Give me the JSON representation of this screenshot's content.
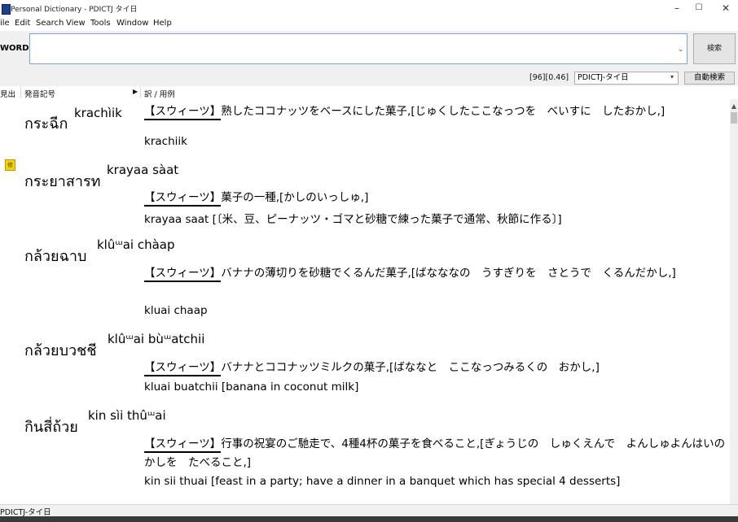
{
  "window": {
    "title": "Personal Dictionary - PDICTJ タイ日",
    "minimize": "–",
    "maximize": "☐"
  },
  "menu": [
    "ile",
    "Edit",
    "Search",
    "View",
    "Tools",
    "Window",
    "Help"
  ],
  "toolbar": {
    "word_label": "WORD",
    "search_value": "",
    "search_button": "検索"
  },
  "status": {
    "counter": "[96][0.46]",
    "dictionary": "PDICTJ-タイ日",
    "auto_search": "自動検索"
  },
  "columns": {
    "word": "見出",
    "pronunciation": "発音記号",
    "translation": "訳 / 用例"
  },
  "entries": [
    {
      "thai": "กระฉีก",
      "pron": "krachìik",
      "gloss": "【スウィーツ】熟したココナッツをベースにした菓子,[じゅくしたここなっつを　べいすに　したおかし,]",
      "extra": "krachiik"
    },
    {
      "thai": "กระยาสารท",
      "pron": "krayaa sàat",
      "gloss": "【スウィーツ】菓子の一種,[かしのいっしゅ,]",
      "extra": "krayaa saat [〔米、豆、ピーナッツ・ゴマと砂糖で練った菓子で通常、秋節に作る〕]"
    },
    {
      "thai": "กล้วยฉาบ",
      "pron": "klûᵚai chàap",
      "gloss": "【スウィーツ】バナナの薄切りを砂糖でくるんだ菓子,[ばなななの　うすぎりを　さとうで　くるんだかし,]",
      "extra": "kluai chaap"
    },
    {
      "thai": "กล้วยบวชชี",
      "pron": "klûᵚai bùᵚatchii",
      "gloss": "【スウィーツ】バナナとココナッツミルクの菓子,[ばななと　ここなっつみるくの　おかし,]",
      "extra": "kluai buatchii [banana in coconut milk]"
    },
    {
      "thai": "กินสี่ถ้วย",
      "pron": "kin sìi thûᵚai",
      "gloss": "【スウィーツ】行事の祝宴のご馳走で、4種4杯の菓子を食べること,[ぎょうじの　しゅくえんで　よんしゅよんはいの　かしを　たべること,]",
      "extra": "kin sii thuai [feast in a party; have a dinner in a banquet which has special 4 desserts]"
    }
  ],
  "statusbar": {
    "text": "PDICTJ-タイ日"
  },
  "colors": {
    "input_border": "#7aa3d4",
    "bookmark": "#f5d200",
    "chrome": "#f0f0f0"
  }
}
